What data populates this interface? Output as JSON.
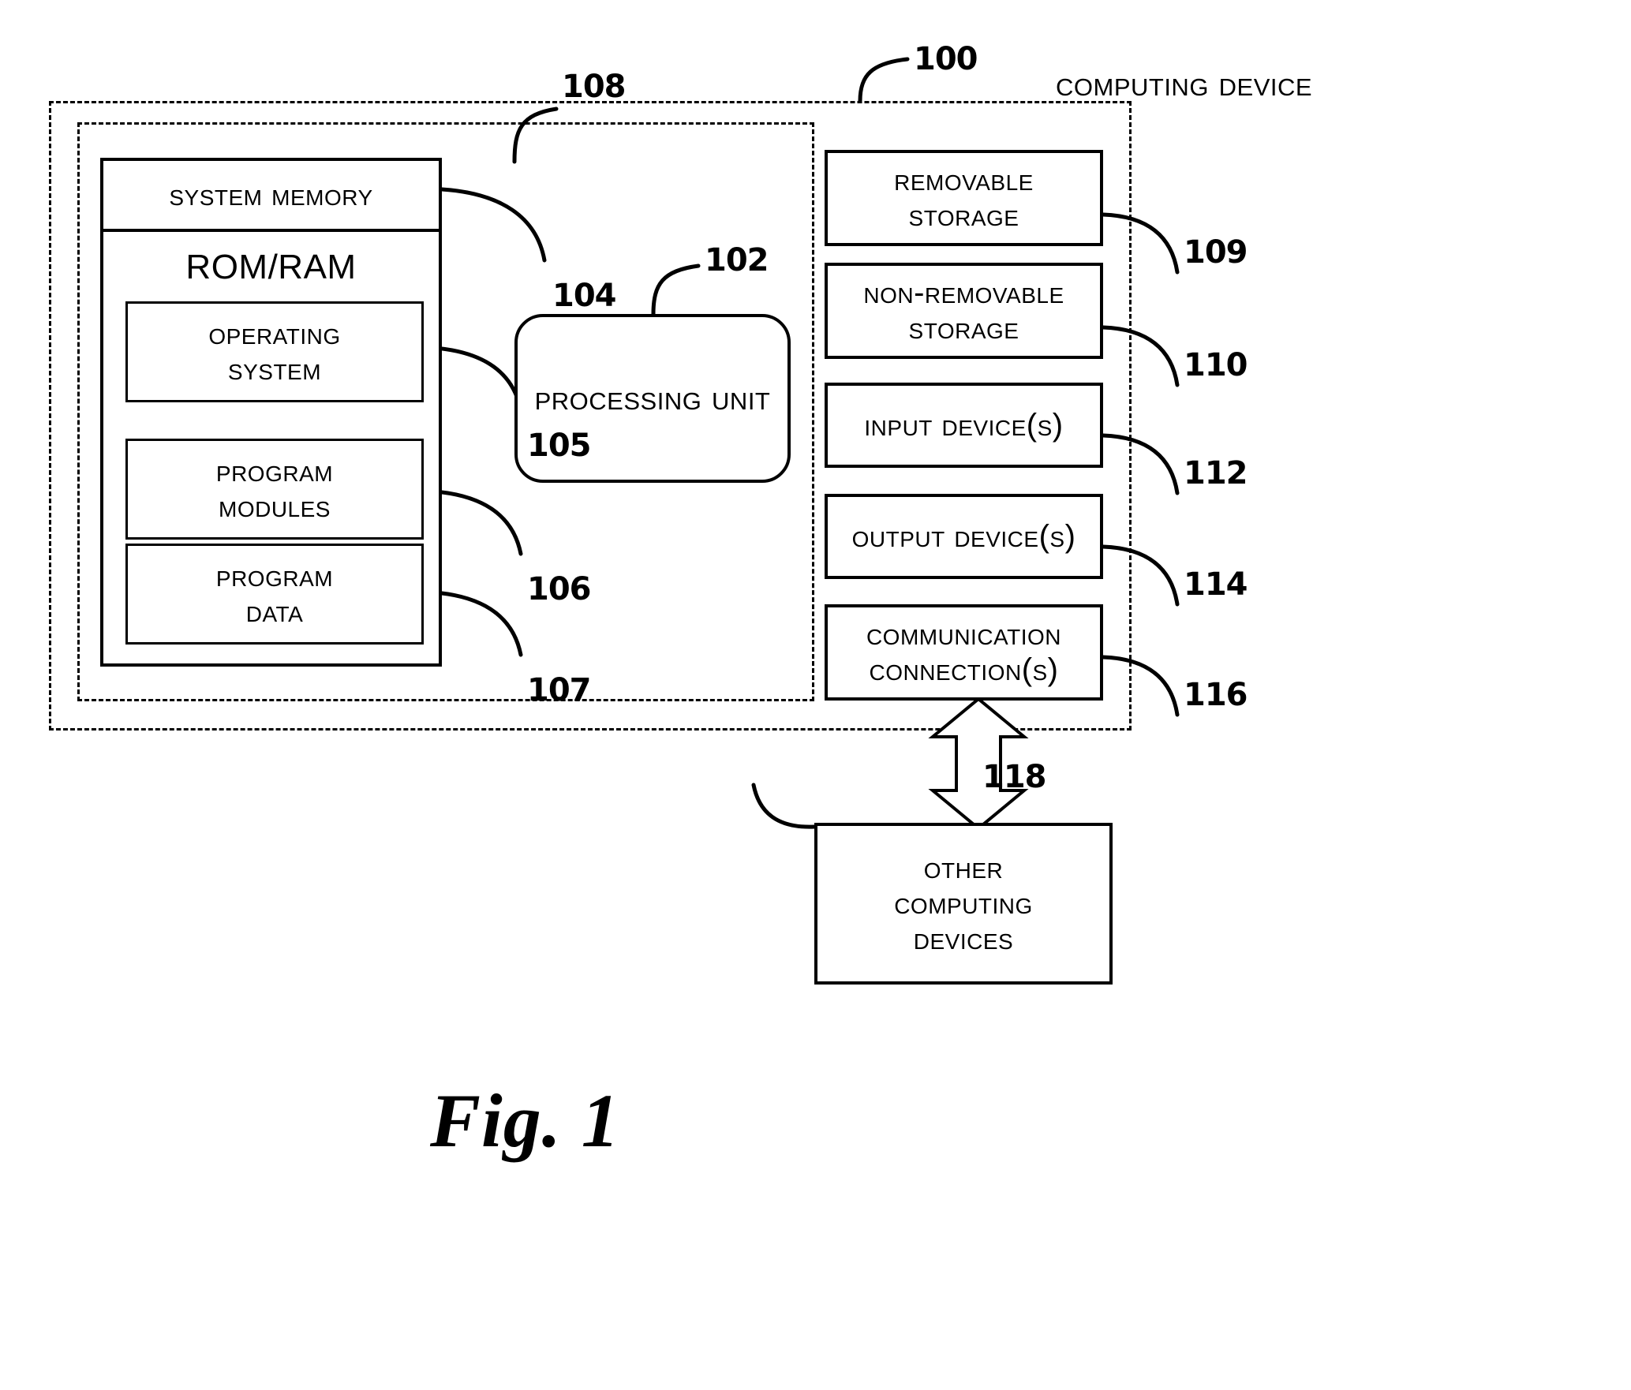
{
  "figure": {
    "caption": "Fig. 1",
    "header_label": "COMPUTING DEVICE"
  },
  "enclosures": {
    "computing_device": {
      "ref": "100",
      "label": "COMPUTING DEVICE"
    },
    "system_memory_region": {
      "ref": "108"
    }
  },
  "memory": {
    "title": "SYSTEM MEMORY",
    "ref_title": "104",
    "subtitle": "ROM/RAM",
    "blocks": [
      {
        "lines": [
          "OPERATING",
          "SYSTEM"
        ],
        "ref": "105"
      },
      {
        "lines": [
          "PROGRAM",
          "MODULES"
        ],
        "ref": "106"
      },
      {
        "lines": [
          "PROGRAM",
          "DATA"
        ],
        "ref": "107"
      }
    ]
  },
  "processing_unit": {
    "label": "PROCESSING UNIT",
    "ref": "102"
  },
  "peripherals": [
    {
      "lines": [
        "REMOVABLE",
        "STORAGE"
      ],
      "ref": "109"
    },
    {
      "lines": [
        "NON-REMOVABLE",
        "STORAGE"
      ],
      "ref": "110"
    },
    {
      "lines": [
        "INPUT DEVICE(S)"
      ],
      "ref": "112"
    },
    {
      "lines": [
        "OUTPUT DEVICE(S)"
      ],
      "ref": "114"
    },
    {
      "lines": [
        "COMMUNICATION",
        "CONNECTION(S)"
      ],
      "ref": "116"
    }
  ],
  "external": {
    "lines": [
      "OTHER",
      "COMPUTING",
      "DEVICES"
    ],
    "ref": "118"
  },
  "colors": {
    "ink": "#000000",
    "paper": "#ffffff"
  }
}
